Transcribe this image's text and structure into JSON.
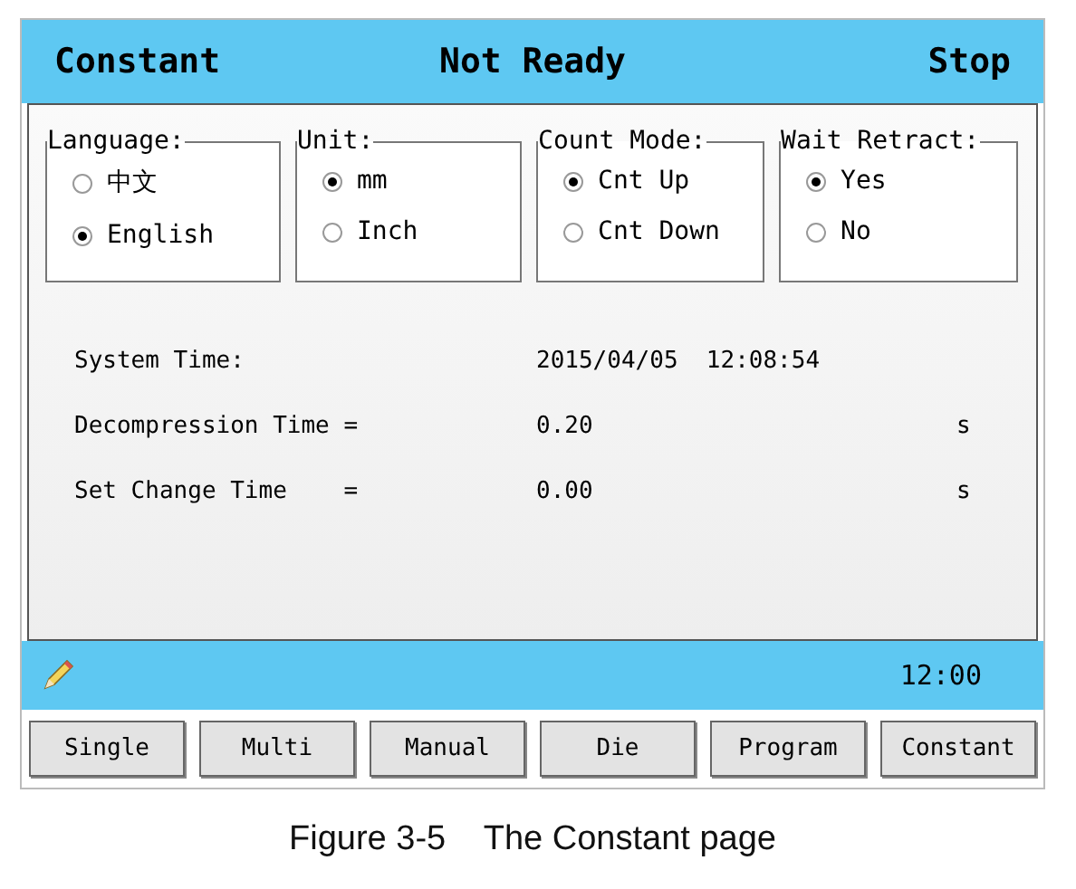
{
  "header": {
    "mode": "Constant",
    "status": "Not Ready",
    "state": "Stop"
  },
  "groups": [
    {
      "title": "Language:",
      "options": [
        {
          "label": "中文",
          "selected": false
        },
        {
          "label": "English",
          "selected": true
        }
      ]
    },
    {
      "title": "Unit:",
      "options": [
        {
          "label": "mm",
          "selected": true
        },
        {
          "label": "Inch",
          "selected": false
        }
      ]
    },
    {
      "title": "Count Mode:",
      "options": [
        {
          "label": "Cnt Up",
          "selected": true
        },
        {
          "label": "Cnt Down",
          "selected": false
        }
      ]
    },
    {
      "title": "Wait Retract:",
      "options": [
        {
          "label": "Yes",
          "selected": true
        },
        {
          "label": "No",
          "selected": false
        }
      ]
    }
  ],
  "settings": [
    {
      "label": "System Time:",
      "value": "2015/04/05  12:08:54"
    },
    {
      "label": "Decompression Time =",
      "value": "0.20",
      "unit": "s"
    },
    {
      "label": "Set Change Time    =",
      "value": "0.00",
      "unit": "s"
    }
  ],
  "status_bar": {
    "time": "12:00"
  },
  "buttons": [
    "Single",
    "Multi",
    "Manual",
    "Die",
    "Program",
    "Constant"
  ],
  "caption": "Figure 3-5    The Constant page"
}
